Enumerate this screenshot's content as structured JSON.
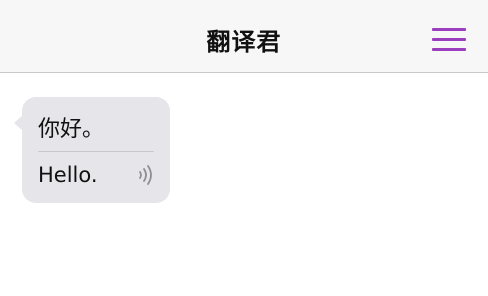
{
  "navbar": {
    "title": "翻译君",
    "menu_icon": "hamburger-menu-icon",
    "accent_color": "#9b3fbf"
  },
  "conversation": {
    "messages": [
      {
        "source_text": "你好。",
        "translation_text": "Hello.",
        "speaker_icon": "speaker-wave-icon"
      }
    ]
  }
}
